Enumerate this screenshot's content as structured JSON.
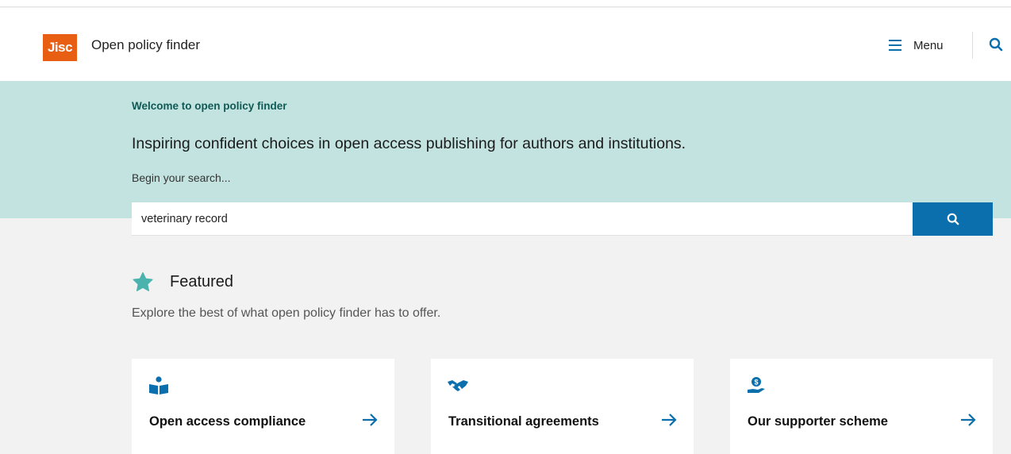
{
  "header": {
    "logo_text": "Jisc",
    "site_name": "Open policy finder",
    "menu_label": "Menu"
  },
  "hero": {
    "eyebrow": "Welcome to open policy finder",
    "tagline": "Inspiring confident choices in open access publishing for authors and institutions.",
    "search_prompt": "Begin your search...",
    "search_value": "veterinary record"
  },
  "featured": {
    "title": "Featured",
    "subtitle": "Explore the best of what open policy finder has to offer.",
    "cards": [
      {
        "title": "Open access compliance",
        "icon": "reader-icon"
      },
      {
        "title": "Transitional agreements",
        "icon": "handshake-icon"
      },
      {
        "title": "Our supporter scheme",
        "icon": "hand-coin-icon"
      }
    ]
  },
  "colors": {
    "brand_orange": "#e85e13",
    "accent_blue": "#0b6fae",
    "hero_teal": "#c3e3e0",
    "star_teal": "#4bb3ad"
  }
}
